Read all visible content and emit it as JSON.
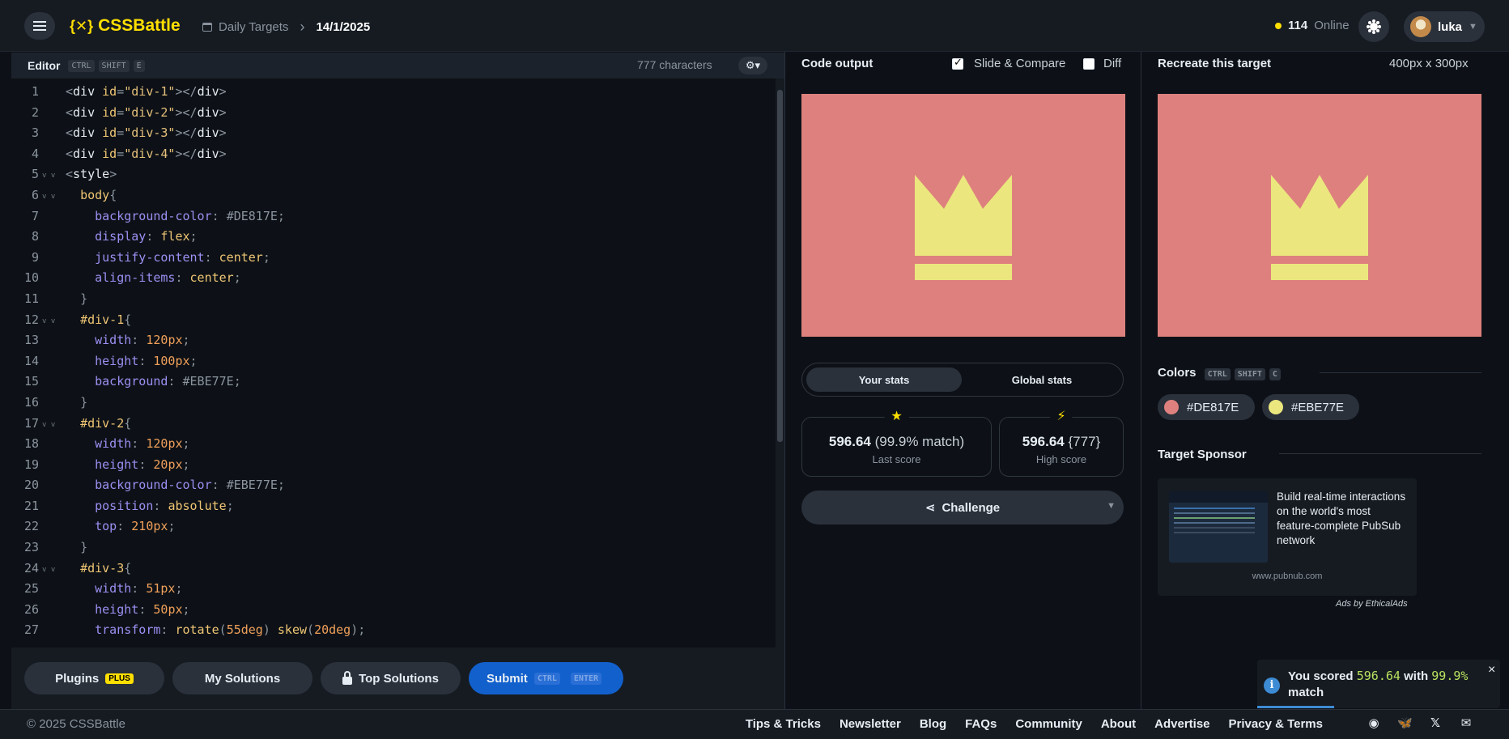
{
  "header": {
    "logo_mark": "{✕}",
    "logo_text": "CSSBattle",
    "breadcrumb_root": "Daily Targets",
    "breadcrumb_current": "14/1/2025",
    "online_count": "114",
    "online_label": "Online",
    "username": "luka"
  },
  "editor": {
    "title": "Editor",
    "shortcut": [
      "CTRL",
      "SHIFT",
      "E"
    ],
    "char_count": "777 characters",
    "lines": [
      [
        "<div id=\"div-1\"></div>"
      ],
      [
        "<div id=\"div-2\"></div>"
      ],
      [
        "<div id=\"div-3\"></div>"
      ],
      [
        "<div id=\"div-4\"></div>"
      ],
      [
        "<style>"
      ],
      [
        "  body{"
      ],
      [
        "    background-color: #DE817E;"
      ],
      [
        "    display: flex;"
      ],
      [
        "    justify-content: center;"
      ],
      [
        "    align-items: center;"
      ],
      [
        "  }"
      ],
      [
        "  #div-1{"
      ],
      [
        "    width: 120px;"
      ],
      [
        "    height: 100px;"
      ],
      [
        "    background: #EBE77E;"
      ],
      [
        "  }"
      ],
      [
        "  #div-2{"
      ],
      [
        "    width: 120px;"
      ],
      [
        "    height: 20px;"
      ],
      [
        "    background-color: #EBE77E;"
      ],
      [
        "    position: absolute;"
      ],
      [
        "    top: 210px;"
      ],
      [
        "  }"
      ],
      [
        "  #div-3{"
      ],
      [
        "    width: 51px;"
      ],
      [
        "    height: 50px;"
      ],
      [
        "    transform: rotate(55deg) skew(20deg);"
      ]
    ]
  },
  "buttons": {
    "plugins": "Plugins",
    "plugins_badge": "PLUS",
    "my_solutions": "My Solutions",
    "top_solutions": "Top Solutions",
    "submit": "Submit",
    "submit_kbd": [
      "CTRL",
      "ENTER"
    ]
  },
  "output": {
    "title": "Code output",
    "slide_compare": "Slide & Compare",
    "diff": "Diff",
    "slide_compare_checked": true,
    "diff_checked": false
  },
  "stats": {
    "tab_your": "Your stats",
    "tab_global": "Global stats",
    "last_score": "596.64",
    "last_match": "(99.9% match)",
    "last_label": "Last score",
    "high_score": "596.64",
    "high_chars": "{777}",
    "high_label": "High score",
    "challenge": "Challenge"
  },
  "target": {
    "title": "Recreate this target",
    "dims": "400px x 300px",
    "colors_title": "Colors",
    "colors_shortcut": [
      "CTRL",
      "SHIFT",
      "C"
    ],
    "colors": [
      {
        "hex": "#DE817E",
        "label": "#DE817E"
      },
      {
        "hex": "#EBE77E",
        "label": "#EBE77E"
      }
    ],
    "sponsor_title": "Target Sponsor",
    "sponsor_text": "Build real-time interactions on the world's most feature-complete PubSub network",
    "sponsor_url": "www.pubnub.com",
    "ads_by": "Ads by EthicalAds"
  },
  "toast": {
    "prefix": "You scored",
    "score": "596.64",
    "mid": "with",
    "match": "99.9%",
    "suffix": "match",
    "close": "×"
  },
  "footer": {
    "copyright": "© 2025 CSSBattle",
    "links": [
      "Tips & Tricks",
      "Newsletter",
      "Blog",
      "FAQs",
      "Community",
      "About",
      "Advertise",
      "Privacy & Terms"
    ],
    "icons": [
      "discord-icon",
      "bluesky-icon",
      "x-icon",
      "email-icon"
    ]
  },
  "theme": {
    "bg": "#0d1117",
    "accent": "#ffdf00",
    "submit": "#1260cc"
  }
}
